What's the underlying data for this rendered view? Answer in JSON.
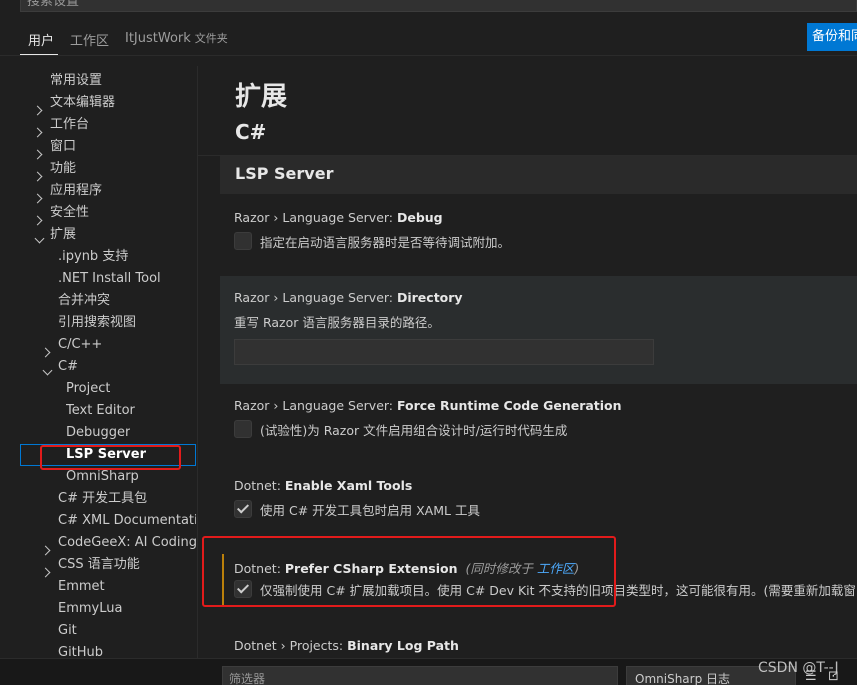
{
  "search": {
    "value": "搜索设置"
  },
  "scopes": [
    {
      "label": "用户"
    },
    {
      "label": "工作区"
    },
    {
      "label": "ItJustWork",
      "sub": "文件夹"
    }
  ],
  "backup_button": "备份和同步设置",
  "toc": {
    "items": [
      {
        "label": "常用设置"
      },
      {
        "label": "文本编辑器"
      },
      {
        "label": "工作台"
      },
      {
        "label": "窗口"
      },
      {
        "label": "功能"
      },
      {
        "label": "应用程序"
      },
      {
        "label": "安全性"
      },
      {
        "label": "扩展"
      },
      {
        "label": ".ipynb 支持"
      },
      {
        "label": ".NET Install Tool"
      },
      {
        "label": "合并冲突"
      },
      {
        "label": "引用搜索视图"
      },
      {
        "label": "C/C++"
      },
      {
        "label": "C#"
      },
      {
        "label": "Project"
      },
      {
        "label": "Text Editor"
      },
      {
        "label": "Debugger"
      },
      {
        "label": "LSP Server"
      },
      {
        "label": "OmniSharp"
      },
      {
        "label": "C# 开发工具包"
      },
      {
        "label": "C# XML Documentati..."
      },
      {
        "label": "CodeGeeX: AI Coding ..."
      },
      {
        "label": "CSS 语言功能"
      },
      {
        "label": "Emmet"
      },
      {
        "label": "EmmyLua"
      },
      {
        "label": "Git"
      },
      {
        "label": "GitHub"
      }
    ]
  },
  "main": {
    "h1": "扩展",
    "h2": "C#",
    "section": "LSP Server",
    "settings": [
      {
        "prefix": "Razor › Language Server: ",
        "name": "Debug",
        "desc": "指定在启动语言服务器时是否等待调试附加。",
        "checked": false
      },
      {
        "prefix": "Razor › Language Server: ",
        "name": "Directory",
        "desc": "重写 Razor 语言服务器目录的路径。",
        "value": ""
      },
      {
        "prefix": "Razor › Language Server: ",
        "name": "Force Runtime Code Generation",
        "desc": "(试验性)为 Razor 文件启用组合设计时/运行时代码生成",
        "checked": false
      },
      {
        "prefix": "Dotnet: ",
        "name": "Enable Xaml Tools",
        "desc": "使用 C# 开发工具包时启用 XAML 工具",
        "checked": true
      },
      {
        "prefix": "Dotnet: ",
        "name": "Prefer CSharp Extension",
        "meta_prefix": "(同时修改于 ",
        "meta_link": "工作区",
        "meta_suffix": ")",
        "desc": "仅强制使用 C# 扩展加载项目。使用 C# Dev Kit 不支持的旧项目类型时，这可能很有用。(需要重新加载窗口)",
        "checked": true
      },
      {
        "prefix": "Dotnet › Projects: ",
        "name": "Binary Log Path"
      }
    ]
  },
  "bottom": {
    "filter_placeholder": "筛选器",
    "channel": "OmniSharp 日志"
  },
  "watermark": "CSDN @T--J"
}
